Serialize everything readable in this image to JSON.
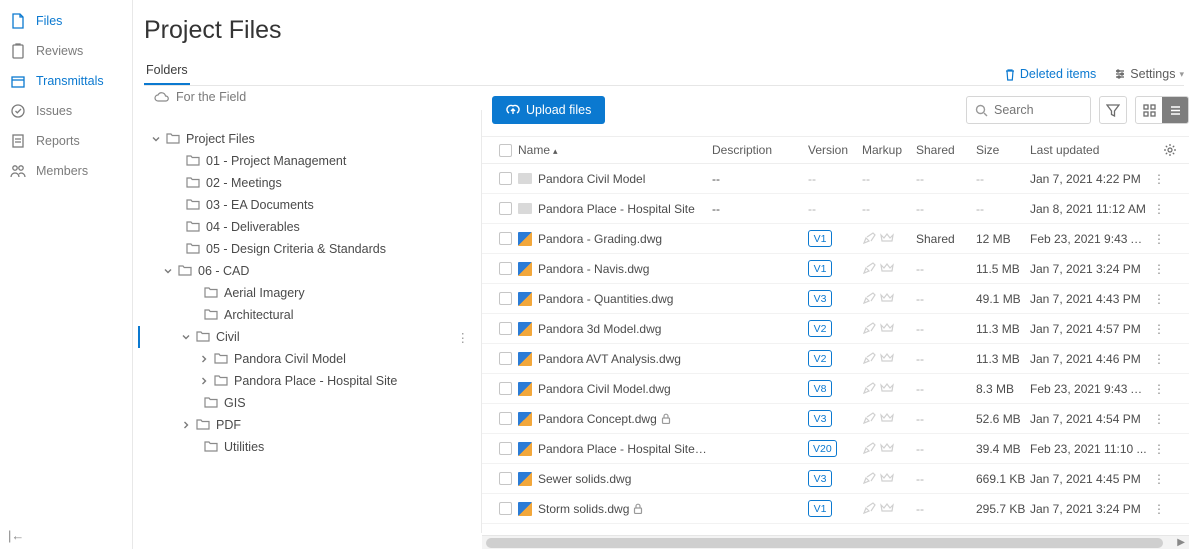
{
  "page_title": "Project Files",
  "leftnav": [
    {
      "label": "Files",
      "icon": "file",
      "active": true
    },
    {
      "label": "Reviews",
      "icon": "clipboard",
      "active": false
    },
    {
      "label": "Transmittals",
      "icon": "box",
      "active": false,
      "highlight": true
    },
    {
      "label": "Issues",
      "icon": "check-circle",
      "active": false
    },
    {
      "label": "Reports",
      "icon": "report",
      "active": false
    },
    {
      "label": "Members",
      "icon": "people",
      "active": false
    }
  ],
  "tab_label": "Folders",
  "deleted_label": "Deleted items",
  "settings_label": "Settings",
  "breadcrumb_label": "For the Field",
  "upload_label": "Upload files",
  "search_placeholder": "Search",
  "tree": {
    "root": "Project Files",
    "children": [
      "01 - Project Management",
      "02 - Meetings",
      "03 - EA Documents",
      "04 - Deliverables",
      "05 - Design Criteria & Standards"
    ],
    "cad": {
      "label": "06 - CAD",
      "children_a": [
        "Aerial Imagery",
        "Architectural"
      ],
      "civil": {
        "label": "Civil",
        "children": [
          "Pandora Civil Model",
          "Pandora Place - Hospital Site"
        ]
      },
      "children_b": [
        "GIS"
      ],
      "pdf": "PDF",
      "children_c": [
        "Utilities"
      ]
    }
  },
  "columns": {
    "name": "Name",
    "description": "Description",
    "version": "Version",
    "markup": "Markup",
    "shared": "Shared",
    "size": "Size",
    "updated": "Last updated"
  },
  "rows": [
    {
      "type": "folder",
      "name": "Pandora Civil Model",
      "desc": "--",
      "ver": "",
      "mark": false,
      "shared": "--",
      "size": "--",
      "updated": "Jan 7, 2021 4:22 PM"
    },
    {
      "type": "folder",
      "name": "Pandora Place - Hospital Site",
      "desc": "--",
      "ver": "",
      "mark": false,
      "shared": "--",
      "size": "--",
      "updated": "Jan 8, 2021 11:12 AM"
    },
    {
      "type": "dwg",
      "name": "Pandora - Grading.dwg",
      "desc": "",
      "ver": "V1",
      "mark": true,
      "shared": "Shared",
      "size": "12 MB",
      "updated": "Feb 23, 2021 9:43 A..."
    },
    {
      "type": "dwg",
      "name": "Pandora - Navis.dwg",
      "desc": "",
      "ver": "V1",
      "mark": true,
      "shared": "--",
      "size": "11.5 MB",
      "updated": "Jan 7, 2021 3:24 PM"
    },
    {
      "type": "dwg",
      "name": "Pandora - Quantities.dwg",
      "desc": "",
      "ver": "V3",
      "mark": true,
      "shared": "--",
      "size": "49.1 MB",
      "updated": "Jan 7, 2021 4:43 PM"
    },
    {
      "type": "dwg",
      "name": "Pandora 3d Model.dwg",
      "desc": "",
      "ver": "V2",
      "mark": true,
      "shared": "--",
      "size": "11.3 MB",
      "updated": "Jan 7, 2021 4:57 PM"
    },
    {
      "type": "dwg",
      "name": "Pandora AVT Analysis.dwg",
      "desc": "",
      "ver": "V2",
      "mark": true,
      "shared": "--",
      "size": "11.3 MB",
      "updated": "Jan 7, 2021 4:46 PM"
    },
    {
      "type": "dwg",
      "name": "Pandora Civil Model.dwg",
      "desc": "",
      "ver": "V8",
      "mark": true,
      "shared": "--",
      "size": "8.3 MB",
      "updated": "Feb 23, 2021 9:43 A..."
    },
    {
      "type": "dwg",
      "name": "Pandora Concept.dwg",
      "desc": "",
      "ver": "V3",
      "mark": true,
      "shared": "--",
      "size": "52.6 MB",
      "updated": "Jan 7, 2021 4:54 PM",
      "locked": true
    },
    {
      "type": "dwg",
      "name": "Pandora Place - Hospital Site.dwg",
      "desc": "",
      "ver": "V20",
      "mark": true,
      "shared": "--",
      "size": "39.4 MB",
      "updated": "Feb 23, 2021 11:10 ..."
    },
    {
      "type": "dwg",
      "name": "Sewer solids.dwg",
      "desc": "",
      "ver": "V3",
      "mark": true,
      "shared": "--",
      "size": "669.1 KB",
      "updated": "Jan 7, 2021 4:45 PM"
    },
    {
      "type": "dwg",
      "name": "Storm solids.dwg",
      "desc": "",
      "ver": "V1",
      "mark": true,
      "shared": "--",
      "size": "295.7 KB",
      "updated": "Jan 7, 2021 3:24 PM",
      "locked": true
    }
  ],
  "dash": "--"
}
